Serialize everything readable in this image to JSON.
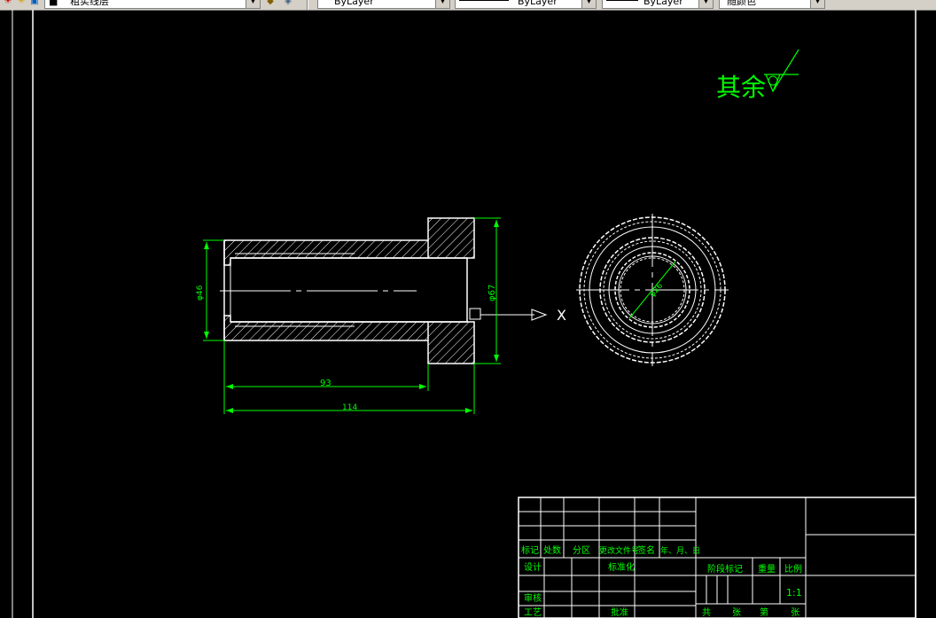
{
  "toolbar": {
    "layer_name": "粗实线层",
    "linetype_label": "ByLayer",
    "lineweight_label": "ByLayer",
    "plotstyle_label": "ByLayer",
    "color_label": "随颜色"
  },
  "drawing": {
    "roughness_note": "其余",
    "dims": {
      "dia_small": "φ46",
      "dia_large": "φ67",
      "len_93": "93",
      "len_114": "114",
      "dia_inner": "φ26"
    },
    "view_label": "X"
  },
  "title_block": {
    "headers": [
      "标记",
      "处数",
      "分区",
      "更改文件号",
      "签名",
      "年、月、日"
    ],
    "design": "设计",
    "standardize": "标准化",
    "review": "审核",
    "process": "工艺",
    "approve": "批准",
    "stage_mark": "阶段标记",
    "weight": "重量",
    "scale_label": "比例",
    "scale_value": "1:1",
    "total": "共",
    "sheets1": "张",
    "page": "第",
    "sheets2": "张"
  },
  "colors": {
    "background": "#000000",
    "geometry": "#ffffff",
    "annotation": "#00ff00"
  }
}
